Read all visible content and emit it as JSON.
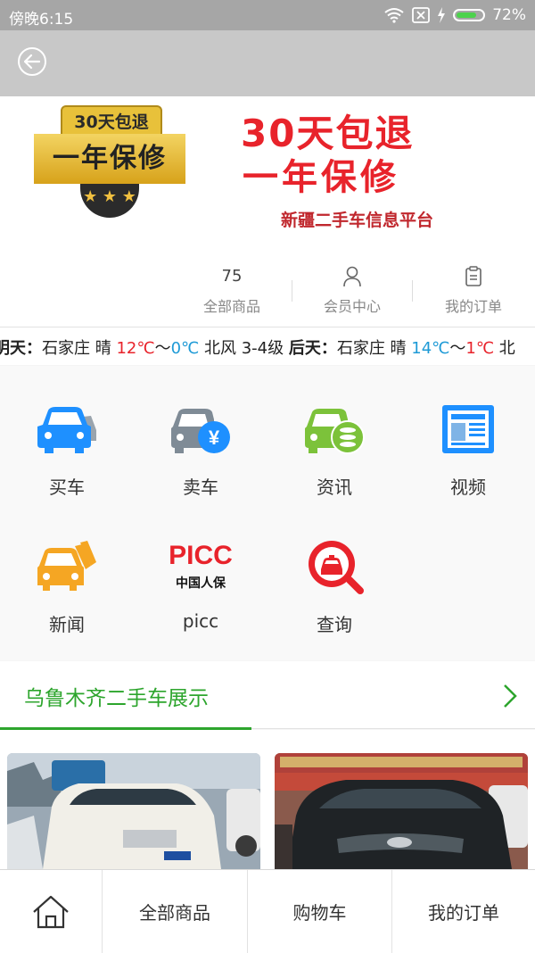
{
  "status": {
    "time": "傍晚6:15",
    "battery": "72%",
    "battery_level": 0.72
  },
  "banner": {
    "badge_top": "30天包退",
    "badge_main": "一年保修",
    "badge_stars": "★ ★ ★",
    "title_line1": "30天包退",
    "title_line2": "一年保修",
    "subtitle": "新疆二手车信息平台"
  },
  "stats": {
    "products_count": "75",
    "products_label": "全部商品",
    "member_label": "会员中心",
    "orders_label": "我的订单"
  },
  "ticker": {
    "day1": "明天：",
    "city1": "石家庄 晴 ",
    "high1": "12℃",
    "sep1": "～",
    "low1": "0℃",
    "wind1": " 北风 3-4级 ",
    "day2": "后天：",
    "city2": "石家庄 晴 ",
    "high2": "14℃",
    "sep2": "～",
    "low2": "1℃",
    "tail": " 北"
  },
  "grid": [
    {
      "label": "买车"
    },
    {
      "label": "卖车"
    },
    {
      "label": "资讯"
    },
    {
      "label": "视频"
    },
    {
      "label": "新闻"
    },
    {
      "label": "picc"
    },
    {
      "label": "查询"
    }
  ],
  "picc": {
    "logo": "PICC",
    "sub": "中国人保"
  },
  "section": {
    "title": "乌鲁木齐二手车展示"
  },
  "tabbar": {
    "all": "全部商品",
    "cart": "购物车",
    "orders": "我的订单"
  },
  "colors": {
    "green": "#2da52d",
    "blue": "#1e90ff",
    "red": "#e8232b"
  }
}
